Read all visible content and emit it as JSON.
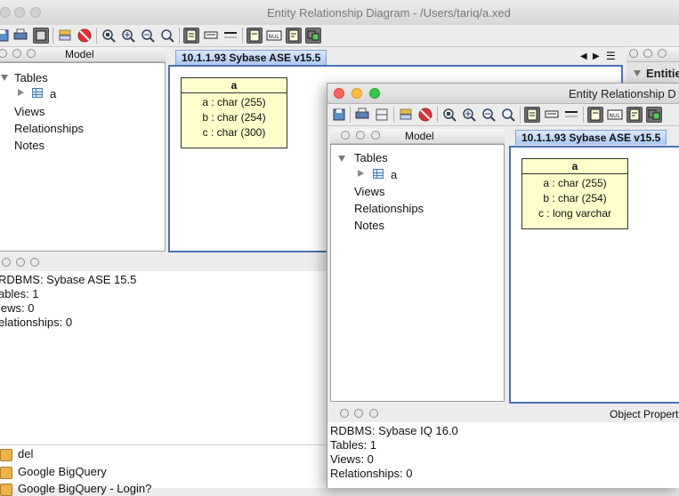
{
  "main_window": {
    "title": "Entity Relationship Diagram - /Users/tariq/a.xed",
    "model_panel": {
      "title": "Model",
      "tables_label": "Tables",
      "table_item": "a",
      "views_label": "Views",
      "relationships_label": "Relationships",
      "notes_label": "Notes"
    },
    "tab_label": "10.1.1.93 Sybase ASE v15.5",
    "entity": {
      "name": "a",
      "columns": [
        "a : char (255)",
        "b : char (254)",
        "c : char (300)"
      ]
    },
    "right_panel_label": "Entitie",
    "info": {
      "rdbms": "RDBMS: Sybase ASE 15.5",
      "tables": "ables: 1",
      "views": "iews: 0",
      "relationships": "elationships: 0"
    },
    "connections": [
      "del",
      "Google BigQuery",
      "Google BigQuery - Login?"
    ]
  },
  "front_window": {
    "title": "Entity Relationship D",
    "model_panel": {
      "title": "Model",
      "tables_label": "Tables",
      "table_item": "a",
      "views_label": "Views",
      "relationships_label": "Relationships",
      "notes_label": "Notes"
    },
    "tab_label": "10.1.1.93 Sybase ASE v15.5",
    "entity": {
      "name": "a",
      "columns": [
        "a : char (255)",
        "b : char (254)",
        "c : long varchar"
      ]
    },
    "properties_title": "Object Propert",
    "info": {
      "rdbms": "RDBMS: Sybase IQ 16.0",
      "tables": "Tables: 1",
      "views": "Views: 0",
      "relationships": "Relationships: 0"
    }
  },
  "colors": {
    "canvas_border": "#4b72b4",
    "entity_fill": "#ffffcc",
    "tab_fill": "#aac8f2"
  }
}
